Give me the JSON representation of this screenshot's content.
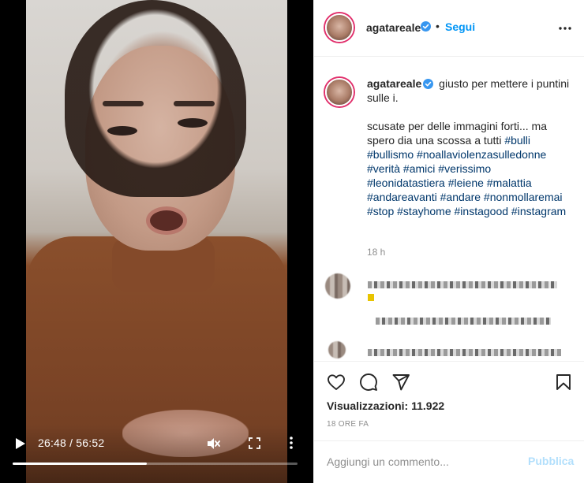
{
  "video": {
    "time_display": "26:48 / 56:52",
    "progress_fraction": 0.471,
    "muted": true
  },
  "header": {
    "username": "agatareale",
    "separator": "•",
    "follow_label": "Segui"
  },
  "caption": {
    "username": "agatareale",
    "first_line": "giusto per mettere i puntini sulle i.",
    "second_para": "scusate per delle immagini forti... ma spero dia una scossa a tutti",
    "hashtags": [
      "#bulli",
      "#bullismo",
      "#noallaviolenzasulledonne",
      "#verità",
      "#amici",
      "#verissimo",
      "#leonidatastiera",
      "#leiene",
      "#malattia",
      "#andareavanti",
      "#andare",
      "#nonmollaremai",
      "#stop",
      "#stayhome",
      "#instagood",
      "#instagram"
    ],
    "timestamp": "18 h"
  },
  "stats": {
    "views_label": "Visualizzazioni:",
    "views_count": "11.922",
    "date": "18 ORE FA"
  },
  "comment_box": {
    "placeholder": "Aggiungi un commento...",
    "publish_label": "Pubblica"
  },
  "colors": {
    "accent": "#0095f6",
    "publish_disabled": "#b2dffc",
    "hashtag": "#00376b",
    "verified": "#3897f0"
  },
  "icons": {
    "play": "play-icon",
    "mute": "mute-icon",
    "fullscreen": "fullscreen-icon",
    "more_video": "more-vertical-icon",
    "options": "more-horizontal-icon",
    "like": "heart-icon",
    "comment": "comment-icon",
    "share": "send-icon",
    "save": "bookmark-icon"
  }
}
